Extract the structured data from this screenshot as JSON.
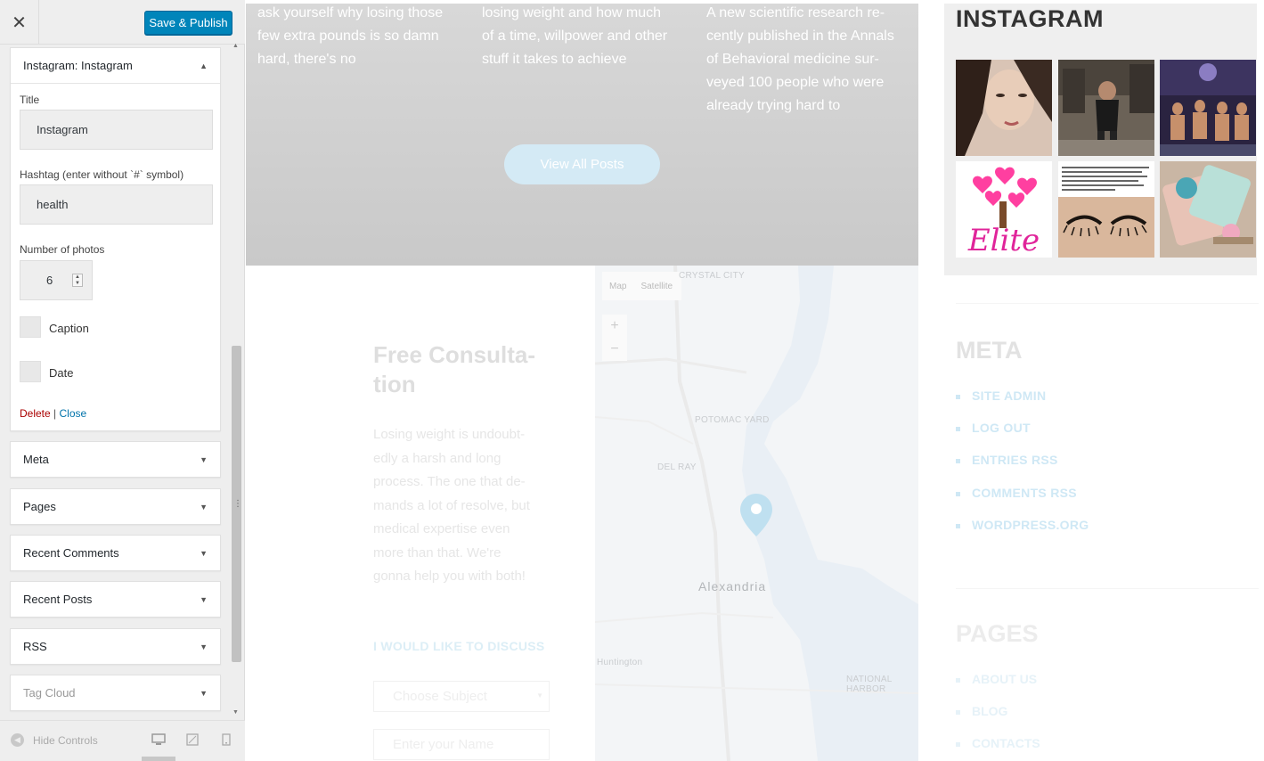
{
  "customizer": {
    "close_icon": "close-icon",
    "publish_label": "Save & Publish",
    "open_widget": {
      "type_label": "Instagram:",
      "name_label": "Instagram",
      "title_label": "Title",
      "title_value": "Instagram",
      "hashtag_label": "Hashtag (enter without `#` symbol)",
      "hashtag_value": "health",
      "photos_label": "Number of photos",
      "photos_value": "6",
      "caption_label": "Caption",
      "date_label": "Date",
      "delete_label": "Delete",
      "separator": "|",
      "close_label": "Close"
    },
    "widgets": [
      "Meta",
      "Pages",
      "Recent Comments",
      "Recent Posts",
      "RSS",
      "Tag Cloud"
    ],
    "footer": {
      "hide_label": "Hide Controls",
      "devices": [
        "desktop-icon",
        "tablet-icon",
        "mobile-icon"
      ]
    }
  },
  "preview": {
    "posts": [
      [
        "ask yourself why losing those",
        "few extra pounds is so damn",
        "hard, there's no"
      ],
      [
        "losing weight and how much",
        "of a time, willpower and other",
        "stuff it takes to achieve"
      ],
      [
        "A new scientific research re-",
        "cently published in the Annals",
        "of Behavioral medicine sur-",
        "veyed 100 people who were",
        "already trying hard to"
      ]
    ],
    "view_all": "View All Posts",
    "consult_title": [
      "Free Consulta-",
      "tion"
    ],
    "consult_text": [
      "Losing weight is undoubt-",
      "edly a harsh and long",
      "process. The one that de-",
      "mands a lot of resolve, but",
      "medical expertise even",
      "more than that. We're",
      "gonna help you with both!"
    ],
    "discuss_label": "I WOULD LIKE TO DISCUSS",
    "subject_placeholder": "Choose Subject",
    "name_placeholder": "Enter your Name",
    "map": {
      "map_btn": "Map",
      "satellite_btn": "Satellite",
      "zoom_in": "+",
      "zoom_out": "−",
      "labels": [
        "CRYSTAL CITY",
        "POTOMAC YARD",
        "DEL RAY",
        "Alexandria",
        "Huntington",
        "NATIONAL HARBOR"
      ]
    },
    "instagram_title": "INSTAGRAM",
    "instagram_elite_text": "Elite",
    "meta_title": "META",
    "meta_items": [
      "SITE ADMIN",
      "LOG OUT",
      "ENTRIES RSS",
      "COMMENTS RSS",
      "WORDPRESS.ORG"
    ],
    "pages_title": "PAGES",
    "pages_items": [
      "ABOUT US",
      "BLOG",
      "CONTACTS"
    ]
  }
}
